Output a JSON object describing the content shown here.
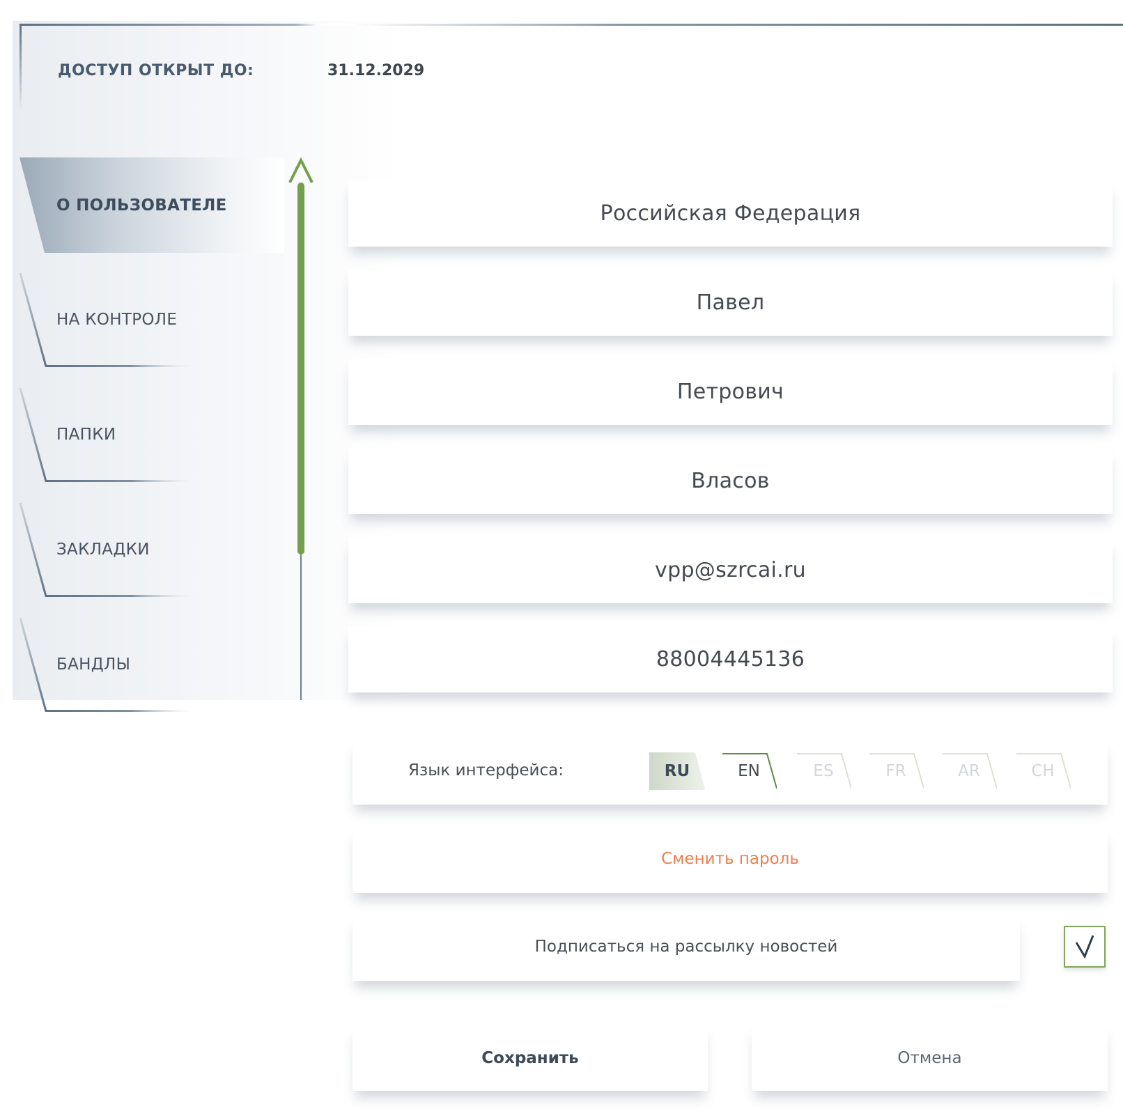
{
  "access": {
    "label": "ДОСТУП ОТКРЫТ ДО:",
    "date": "31.12.2029"
  },
  "sidebar": {
    "items": [
      {
        "label": "О ПОЛЬЗОВАТЕЛЕ",
        "active": true
      },
      {
        "label": "НА КОНТРОЛЕ",
        "active": false
      },
      {
        "label": "ПАПКИ",
        "active": false
      },
      {
        "label": "ЗАКЛАДКИ",
        "active": false
      },
      {
        "label": "БАНДЛЫ",
        "active": false
      }
    ]
  },
  "profile": {
    "country": "Российская Федерация",
    "first_name": "Павел",
    "middle_name": "Петрович",
    "last_name": "Власов",
    "email": "vpp@szrcai.ru",
    "phone": "88004445136"
  },
  "language": {
    "label": "Язык интерфейса:",
    "options": [
      "RU",
      "EN",
      "ES",
      "FR",
      "AR",
      "CH"
    ],
    "selected": "RU"
  },
  "change_password": "Сменить пароль",
  "newsletter": {
    "label": "Подписаться на рассылку новостей",
    "checked": true
  },
  "actions": {
    "save": "Сохранить",
    "cancel": "Отмена"
  },
  "colors": {
    "accent_green": "#74a04e",
    "link_orange": "#ee7f4f",
    "nav_slate": "#5d7183"
  }
}
